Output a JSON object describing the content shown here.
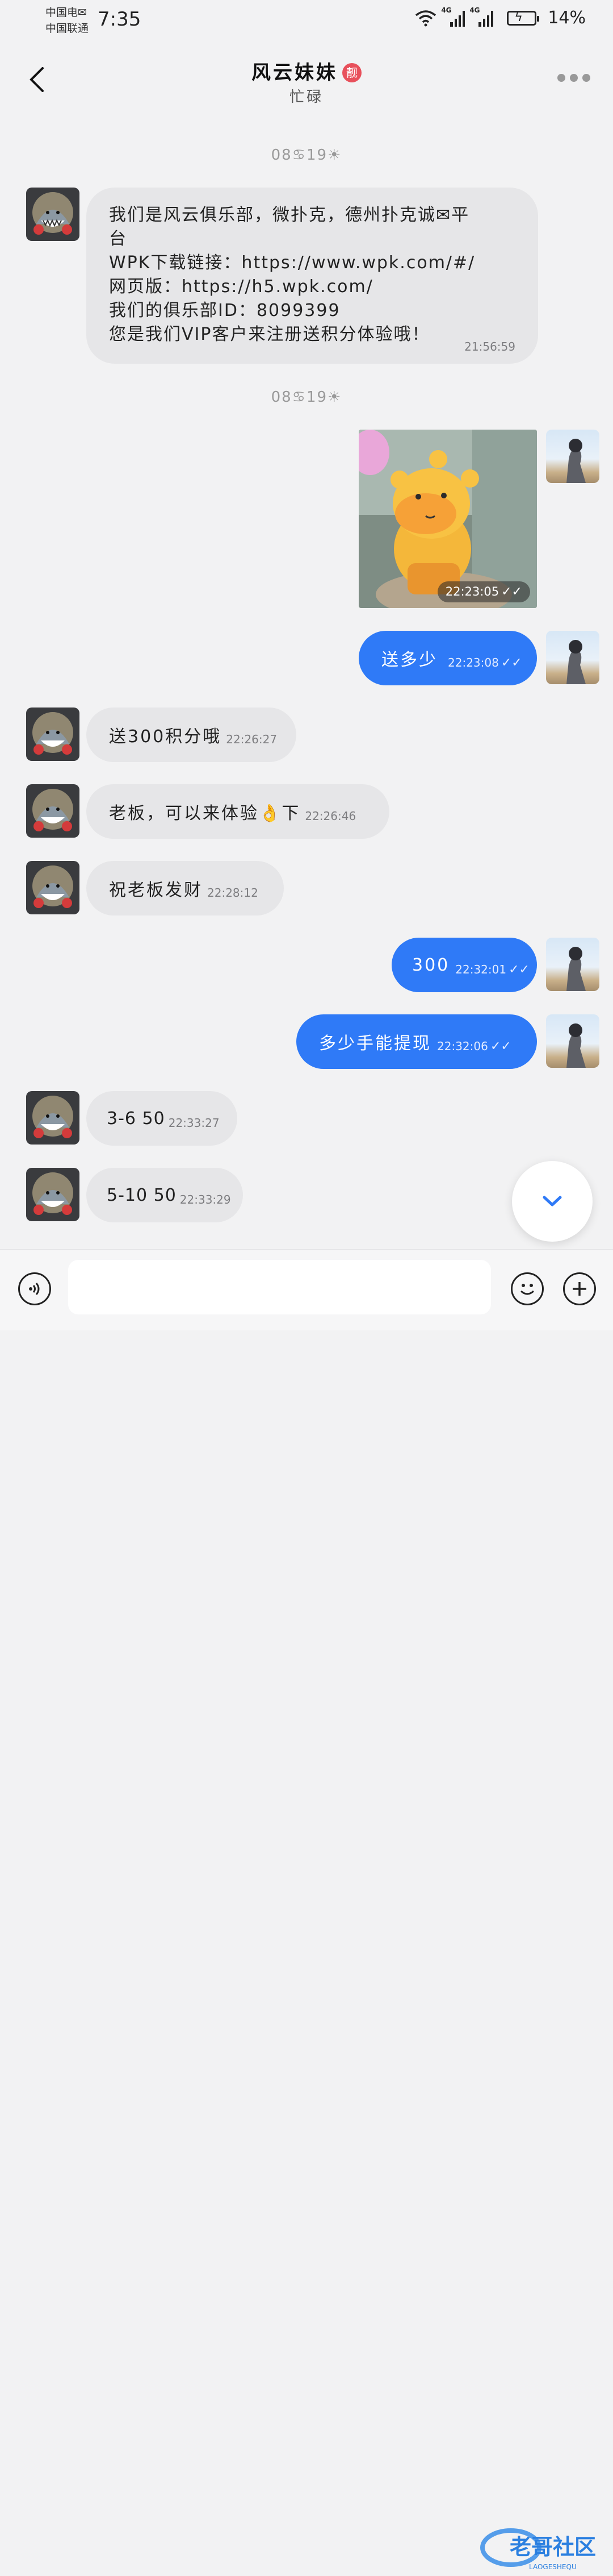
{
  "status_bar": {
    "carrier1": "中国电✉",
    "carrier2": "中国联通",
    "time": "7:35",
    "net1": "4G",
    "net2": "4G",
    "battery": "14%"
  },
  "header": {
    "title": "风云妹妹",
    "badge": "靓",
    "subtitle": "忙碌"
  },
  "dates": [
    "08♋19☀",
    "08♋19☀"
  ],
  "messages": [
    {
      "side": "in",
      "lines": [
        "我们是风云俱乐部，微扑克，德州扑克诚✉平",
        "台",
        "WPK下载链接：https://www.wpk.com/#/",
        "网页版：https://h5.wpk.com/",
        "我们的俱乐部ID：8099399",
        "您是我们VIP客户来注册送积分体验哦！"
      ],
      "time": "21:56:59"
    },
    {
      "side": "out",
      "type": "image",
      "time": "22:23:05",
      "ticks": "✓✓"
    },
    {
      "side": "out",
      "text": "送多少",
      "time": "22:23:08",
      "ticks": "✓✓"
    },
    {
      "side": "in",
      "text": "送300积分哦",
      "time": "22:26:27"
    },
    {
      "side": "in",
      "text": "老板，可以来体验👌下",
      "time": "22:26:46"
    },
    {
      "side": "in",
      "text": "祝老板发财",
      "time": "22:28:12"
    },
    {
      "side": "out",
      "text": "300",
      "time": "22:32:01",
      "ticks": "✓✓"
    },
    {
      "side": "out",
      "text": "多少手能提现",
      "time": "22:32:06",
      "ticks": "✓✓"
    },
    {
      "side": "in",
      "text": "3-6 50",
      "time": "22:33:27"
    },
    {
      "side": "in",
      "text": "5-10 50",
      "time": "22:33:29"
    }
  ],
  "watermark": {
    "text1": "老哥社区",
    "text2": "LAOGESHEQU"
  },
  "colors": {
    "outgoing_bubble": "#2f7af7",
    "incoming_bubble": "#e6e6e8",
    "background": "#f2f2f3",
    "badge": "#e8505b"
  },
  "icons": [
    "back-icon",
    "more-icon",
    "voice-icon",
    "emoji-icon",
    "plus-icon",
    "chevron-down-icon",
    "wifi-icon",
    "signal-icon",
    "battery-icon"
  ]
}
